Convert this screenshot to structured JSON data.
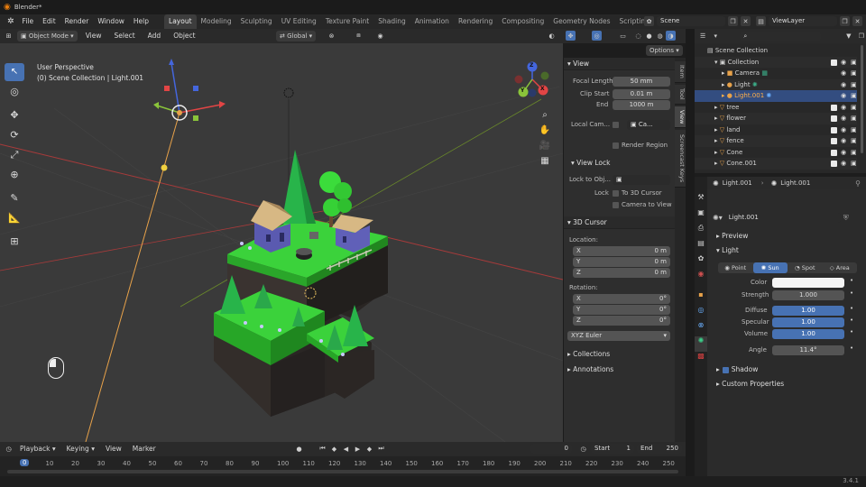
{
  "titlebar": {
    "title": "Blender*"
  },
  "menu": [
    "File",
    "Edit",
    "Render",
    "Window",
    "Help"
  ],
  "workspaces": [
    "Layout",
    "Modeling",
    "Sculpting",
    "UV Editing",
    "Texture Paint",
    "Shading",
    "Animation",
    "Rendering",
    "Compositing",
    "Geometry Nodes",
    "Scripting"
  ],
  "active_workspace": "Layout",
  "scene": {
    "name": "Scene",
    "view_layer": "ViewLayer"
  },
  "viewport_header": {
    "mode": "Object Mode",
    "menus": [
      "View",
      "Select",
      "Add",
      "Object"
    ],
    "transform": "Global",
    "options": "Options"
  },
  "viewport": {
    "overlay_line1": "User Perspective",
    "overlay_line2": "(0) Scene Collection | Light.001",
    "gizmo_axes": {
      "x": "X",
      "y": "Y",
      "z": "Z"
    }
  },
  "npanel": {
    "tabs": [
      "Item",
      "Tool",
      "View",
      "Screencast Keys"
    ],
    "view_title": "View",
    "focal_length_label": "Focal Length",
    "focal_length": "50 mm",
    "clip_start_label": "Clip Start",
    "clip_start": "0.01 m",
    "clip_end_label": "End",
    "clip_end": "1000 m",
    "local_camera_label": "Local Cam...",
    "local_camera_value": "Ca...",
    "render_region": "Render Region",
    "view_lock_title": "View Lock",
    "lock_to_object_label": "Lock to Obj...",
    "lock_label": "Lock",
    "to_3d_cursor": "To 3D Cursor",
    "camera_to_view": "Camera to View",
    "cursor_title": "3D Cursor",
    "location_label": "Location:",
    "loc_x": "0 m",
    "loc_y": "0 m",
    "loc_z": "0 m",
    "rotation_label": "Rotation:",
    "rot_x": "0°",
    "rot_y": "0°",
    "rot_z": "0°",
    "axis_x": "X",
    "axis_y": "Y",
    "axis_z": "Z",
    "rotation_mode": "XYZ Euler",
    "collections": "Collections",
    "annotations": "Annotations"
  },
  "outliner": {
    "root": "Scene Collection",
    "items": [
      {
        "name": "Collection",
        "indent": 1
      },
      {
        "name": "Camera",
        "indent": 2
      },
      {
        "name": "Light",
        "indent": 2
      },
      {
        "name": "Light.001",
        "indent": 2,
        "selected": true
      },
      {
        "name": "tree",
        "indent": 1
      },
      {
        "name": "flower",
        "indent": 1
      },
      {
        "name": "land",
        "indent": 1
      },
      {
        "name": "fence",
        "indent": 1
      },
      {
        "name": "Cone",
        "indent": 1
      },
      {
        "name": "Cone.001",
        "indent": 1
      }
    ]
  },
  "properties": {
    "breadcrumb_object": "Light.001",
    "breadcrumb_data": "Light.001",
    "datablock": "Light.001",
    "preview": "Preview",
    "light_section": "Light",
    "light_types": [
      "Point",
      "Sun",
      "Spot",
      "Area"
    ],
    "active_light_type": "Sun",
    "color_label": "Color",
    "strength_label": "Strength",
    "strength": "1.000",
    "diffuse_label": "Diffuse",
    "diffuse": "1.00",
    "specular_label": "Specular",
    "specular": "1.00",
    "volume_label": "Volume",
    "volume": "1.00",
    "angle_label": "Angle",
    "angle": "11.4°",
    "shadow": "Shadow",
    "custom_properties": "Custom Properties"
  },
  "timeline": {
    "menus": [
      "Playback",
      "Keying",
      "View",
      "Marker"
    ],
    "current_frame": "0",
    "start_label": "Start",
    "start": "1",
    "end_label": "End",
    "end": "250",
    "ticks": [
      "0",
      "10",
      "20",
      "30",
      "40",
      "50",
      "60",
      "70",
      "80",
      "90",
      "100",
      "110",
      "120",
      "130",
      "140",
      "150",
      "160",
      "170",
      "180",
      "190",
      "200",
      "210",
      "220",
      "230",
      "240",
      "250"
    ]
  },
  "status": {
    "version": "3.4.1"
  },
  "colors": {
    "accent": "#4772b3",
    "selection": "#334d80",
    "viewport_bg": "#3a3a3a",
    "grass": "#3bd23b"
  }
}
